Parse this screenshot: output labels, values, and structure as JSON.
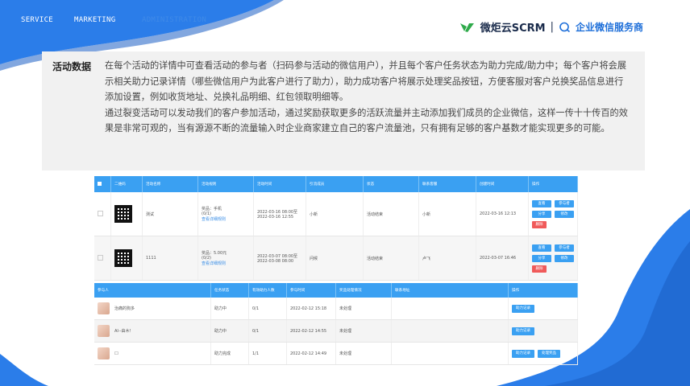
{
  "nav": {
    "items": [
      "SERVICE",
      "MARKETING",
      "ADMINISTRATION"
    ]
  },
  "logo": {
    "brand": "微炬云SCRM",
    "separator": "|",
    "tagline": "企业微信服务商",
    "accent_color": "#1e6fd9",
    "icon_color": "#2eaa4a"
  },
  "section": {
    "label": "活动数据",
    "paragraphs": [
      "在每个活动的详情中可查看活动的参与者（扫码参与活动的微信用户），并且每个客户任务状态为助力完成/助力中；每个客户将会展示相关助力记录详情（哪些微信用户为此客户进行了助力），助力成功客户将展示处理奖品按钮，方便客服对客户兑换奖品信息进行添加设置，例如收货地址、兑换礼品明细、红包领取明细等。",
      "通过裂变活动可以发动我们的客户参加活动，通过奖励获取更多的活跃流量并主动添加我们成员的企业微信，这样一传十十传百的效果是非常可观的，当有源源不断的流量输入时企业商家建立自己的客户流量池，只有拥有足够的客户基数才能实现更多的可能。"
    ]
  },
  "table1": {
    "headers": [
      "",
      "二维码",
      "活动名称",
      "活动规则",
      "活动时间",
      "引流成员",
      "状态",
      "联系客服",
      "创建时间",
      "操作"
    ],
    "rows": [
      {
        "name": "测试",
        "rule_line1": "奖品：手机",
        "rule_line2": "(0/1)",
        "rule_link": "查看详细规则",
        "time_start": "2022-03-16 08:00至",
        "time_end": "2022-03-16 12:55",
        "member": "小新",
        "status": "活动结束",
        "service": "小新",
        "created": "2022-03-16 12:13",
        "ops": [
          "查看",
          "参与者",
          "分享",
          "修改"
        ],
        "delete": "删除"
      },
      {
        "name": "1111",
        "rule_line1": "奖品：5.00元",
        "rule_line2": "(0/2)",
        "rule_link": "查看详细规则",
        "time_start": "2022-03-07 08:00至",
        "time_end": "2022-03-08 08:00",
        "member": "问候",
        "status": "活动结束",
        "service": "卢飞",
        "created": "2022-03-07 16:46",
        "ops": [
          "查看",
          "参与者",
          "分享",
          "修改"
        ],
        "delete": "删除"
      }
    ]
  },
  "table2": {
    "headers": [
      "参与人",
      "任务状态",
      "有效助力人数",
      "参与时间",
      "奖品处理情况",
      "联系地址",
      "操作"
    ],
    "rows": [
      {
        "name": "治痛的狗多",
        "status": "助力中",
        "count": "0/1",
        "time": "2022-02-12 15:18",
        "prize": "未处理",
        "address": "",
        "ops": [
          "助力记录"
        ]
      },
      {
        "name": "AI--由木！",
        "status": "助力中",
        "count": "0/1",
        "time": "2022-02-12 14:55",
        "prize": "未处理",
        "address": "",
        "ops": [
          "助力记录"
        ]
      },
      {
        "name": "□",
        "status": "助力完成",
        "count": "1/1",
        "time": "2022-02-12 14:49",
        "prize": "未处理",
        "address": "",
        "ops": [
          "助力记录",
          "处理奖品"
        ]
      }
    ]
  },
  "colors": {
    "header_blue": "#3aa0f2",
    "wave_blue": "#2b7de9",
    "delete_red": "#f05a5a"
  }
}
